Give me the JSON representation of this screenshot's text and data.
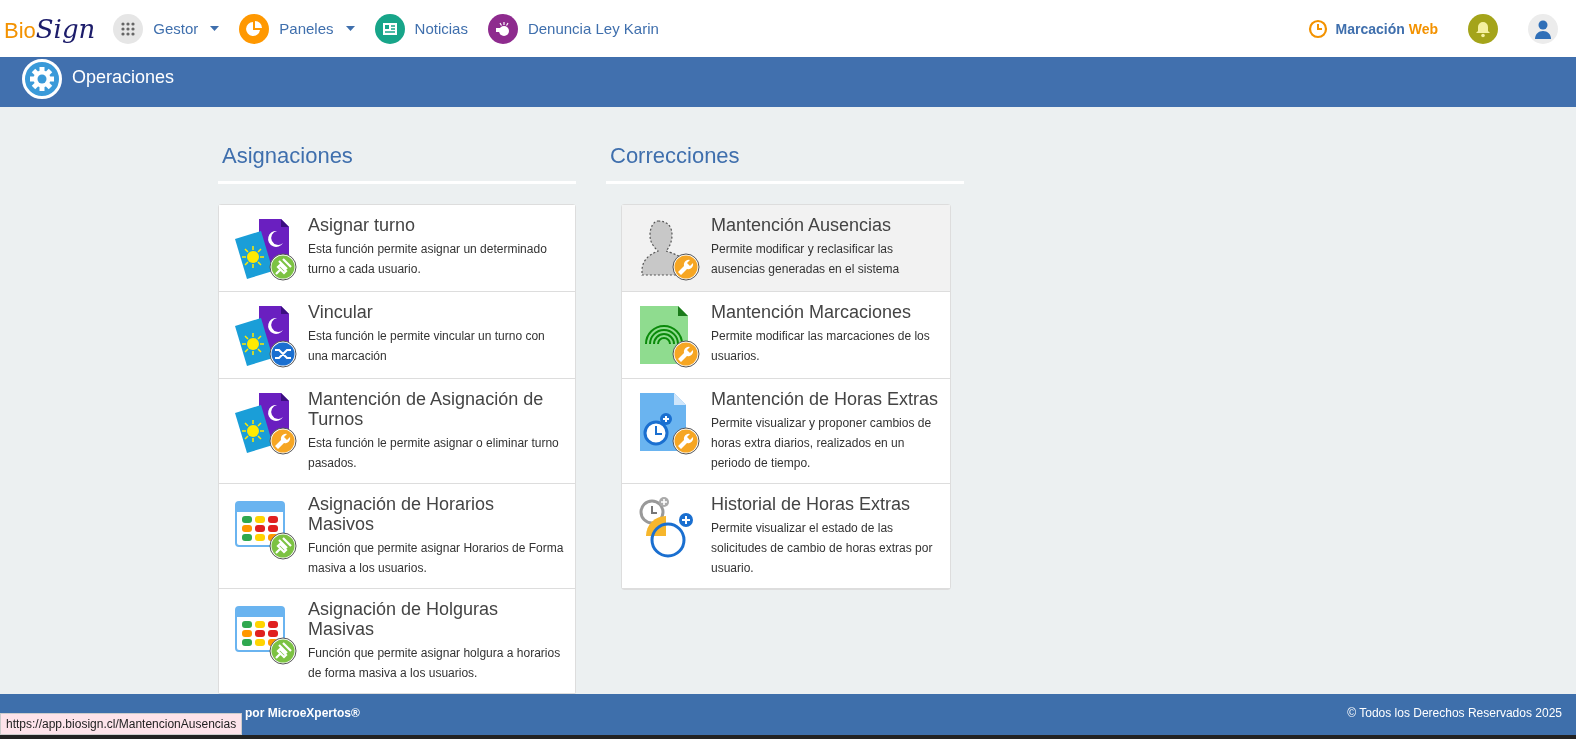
{
  "logo": {
    "first": "Bio",
    "second": "Sign"
  },
  "nav": [
    {
      "label": "Gestor",
      "dropdown": true,
      "color": "#e6e6e6"
    },
    {
      "label": "Paneles",
      "dropdown": true,
      "color": "#ff9800"
    },
    {
      "label": "Noticias",
      "dropdown": false,
      "color": "#17a589"
    },
    {
      "label": "Denuncia Ley Karin",
      "dropdown": false,
      "color": "#8e2b8e"
    }
  ],
  "clock_link": {
    "label": "Marcación",
    "accent": "Web"
  },
  "section_bar": {
    "title": "Operaciones"
  },
  "columns": [
    {
      "title": "Asignaciones",
      "items": [
        {
          "title": "Asignar turno",
          "description": "Esta función permite asignar un determinado turno a cada usuario.",
          "hovered": false
        },
        {
          "title": "Vincular",
          "description": "Esta función le permite vincular un turno con una marcación",
          "hovered": false
        },
        {
          "title": "Mantención de Asignación de Turnos",
          "description": "Esta función le permite asignar o eliminar turno pasados.",
          "hovered": false
        },
        {
          "title": "Asignación de Horarios Masivos",
          "description": "Función que permite asignar Horarios de Forma masiva a los usuarios.",
          "hovered": false
        },
        {
          "title": "Asignación de Holguras Masivas",
          "description": "Función que permite asignar holgura a horarios de forma masiva a los usuarios.",
          "hovered": false
        }
      ]
    },
    {
      "title": "Correcciones",
      "items": [
        {
          "title": "Mantención Ausencias",
          "description": "Permite modificar y reclasificar las ausencias generadas en el sistema",
          "hovered": true
        },
        {
          "title": "Mantención Marcaciones",
          "description": "Permite modificar las marcaciones de los usuarios.",
          "hovered": false
        },
        {
          "title": "Mantención de Horas Extras",
          "description": "Permite visualizar y proponer cambios de horas extra diarios, realizados en un periodo de tiempo.",
          "hovered": false
        },
        {
          "title": "Historial de Horas Extras",
          "description": "Permite visualizar el estado de las solicitudes de cambio de horas extras por usuario.",
          "hovered": false
        }
      ]
    }
  ],
  "footer": {
    "left": "por MicroeXpertos®",
    "right": "© Todos los Derechos Reservados 2025"
  },
  "status_url": "https://app.biosign.cl/MantencionAusencias"
}
